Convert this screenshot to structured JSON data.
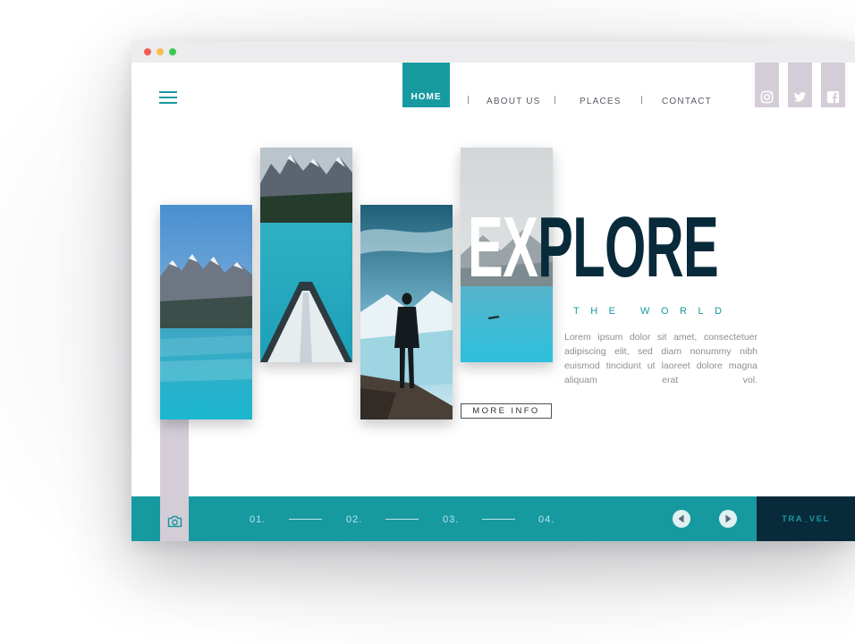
{
  "nav": {
    "home": "HOME",
    "items": [
      "ABOUT US",
      "PLACES",
      "CONTACT"
    ]
  },
  "social": [
    "instagram-icon",
    "twitter-icon",
    "facebook-icon"
  ],
  "hero": {
    "headline_light": "EX",
    "headline_dark": "PLORE",
    "subheadline": "THE WORLD",
    "description": "Lorem ipsum dolor sit amet, consectetuer adipiscing elit, sed diam nonummy nibh euismod tincidunt ut laoreet dolore magna aliquam erat vol.",
    "button": "MORE INFO"
  },
  "footer": {
    "slides": [
      "01.",
      "02.",
      "03.",
      "04."
    ],
    "brand": "TRA_VEL"
  },
  "colors": {
    "accent": "#169aa0",
    "dark": "#082a3a",
    "lilac": "#d4cdd8"
  }
}
